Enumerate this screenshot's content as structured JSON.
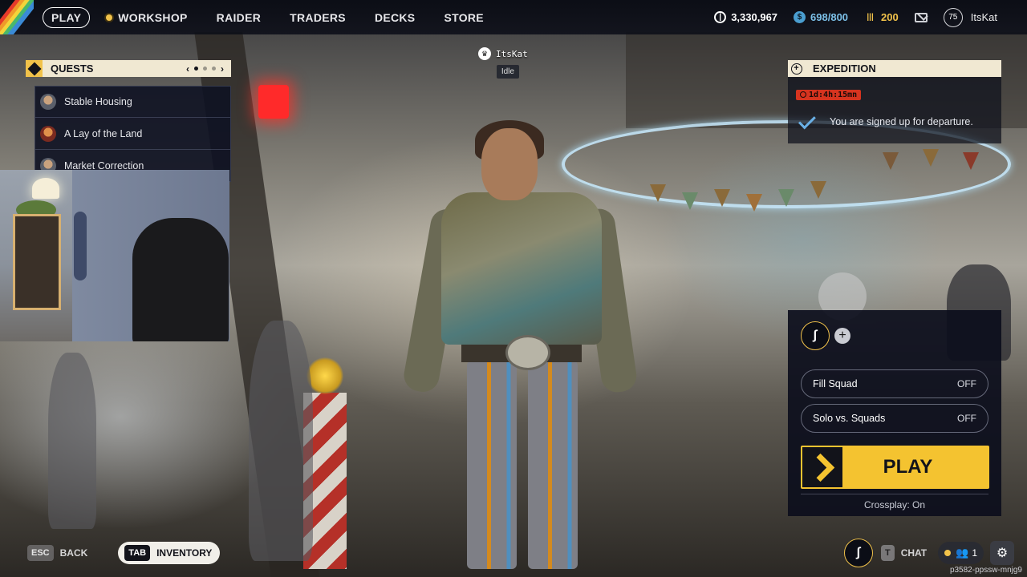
{
  "nav": {
    "tabs": [
      "PLAY",
      "WORKSHOP",
      "RAIDER",
      "TRADERS",
      "DECKS",
      "STORE"
    ],
    "active_tab": "PLAY"
  },
  "currencies": {
    "coins": "3,330,967",
    "credits": "698/800",
    "raider_tokens": "200"
  },
  "profile": {
    "level": "75",
    "username": "ItsKat"
  },
  "quests": {
    "title": "QUESTS",
    "page": 1,
    "pages": 3,
    "items": [
      {
        "name": "Stable Housing"
      },
      {
        "name": "A Lay of the Land"
      },
      {
        "name": "Market Correction"
      }
    ]
  },
  "player_tag": {
    "name": "ItsKat",
    "status": "Idle"
  },
  "expedition": {
    "title": "EXPEDITION",
    "timer": "1d:4h:15mn",
    "message": "You are signed up for departure."
  },
  "squad": {
    "fill_squad_label": "Fill Squad",
    "fill_squad_value": "OFF",
    "solo_label": "Solo vs. Squads",
    "solo_value": "OFF",
    "play_label": "PLAY",
    "crossplay": "Crossplay: On"
  },
  "bottom": {
    "back_key": "ESC",
    "back_label": "BACK",
    "inventory_key": "TAB",
    "inventory_label": "INVENTORY",
    "chat_key": "T",
    "chat_label": "CHAT",
    "friends_count": "1",
    "session_code": "p3582-ppssw-mnjg9"
  },
  "colors": {
    "accent_yellow": "#f4c330",
    "panel_cream": "#f0e8d2",
    "timer_red": "#d6341f",
    "check_blue": "#6ab0e6"
  },
  "icons": [
    "coin-icon",
    "credits-icon",
    "raider-token-icon",
    "mail-icon",
    "crown-icon",
    "clock-icon",
    "check-icon",
    "plus-icon",
    "chevron-left-icon",
    "chevron-right-icon",
    "gear-icon",
    "friends-icon"
  ]
}
